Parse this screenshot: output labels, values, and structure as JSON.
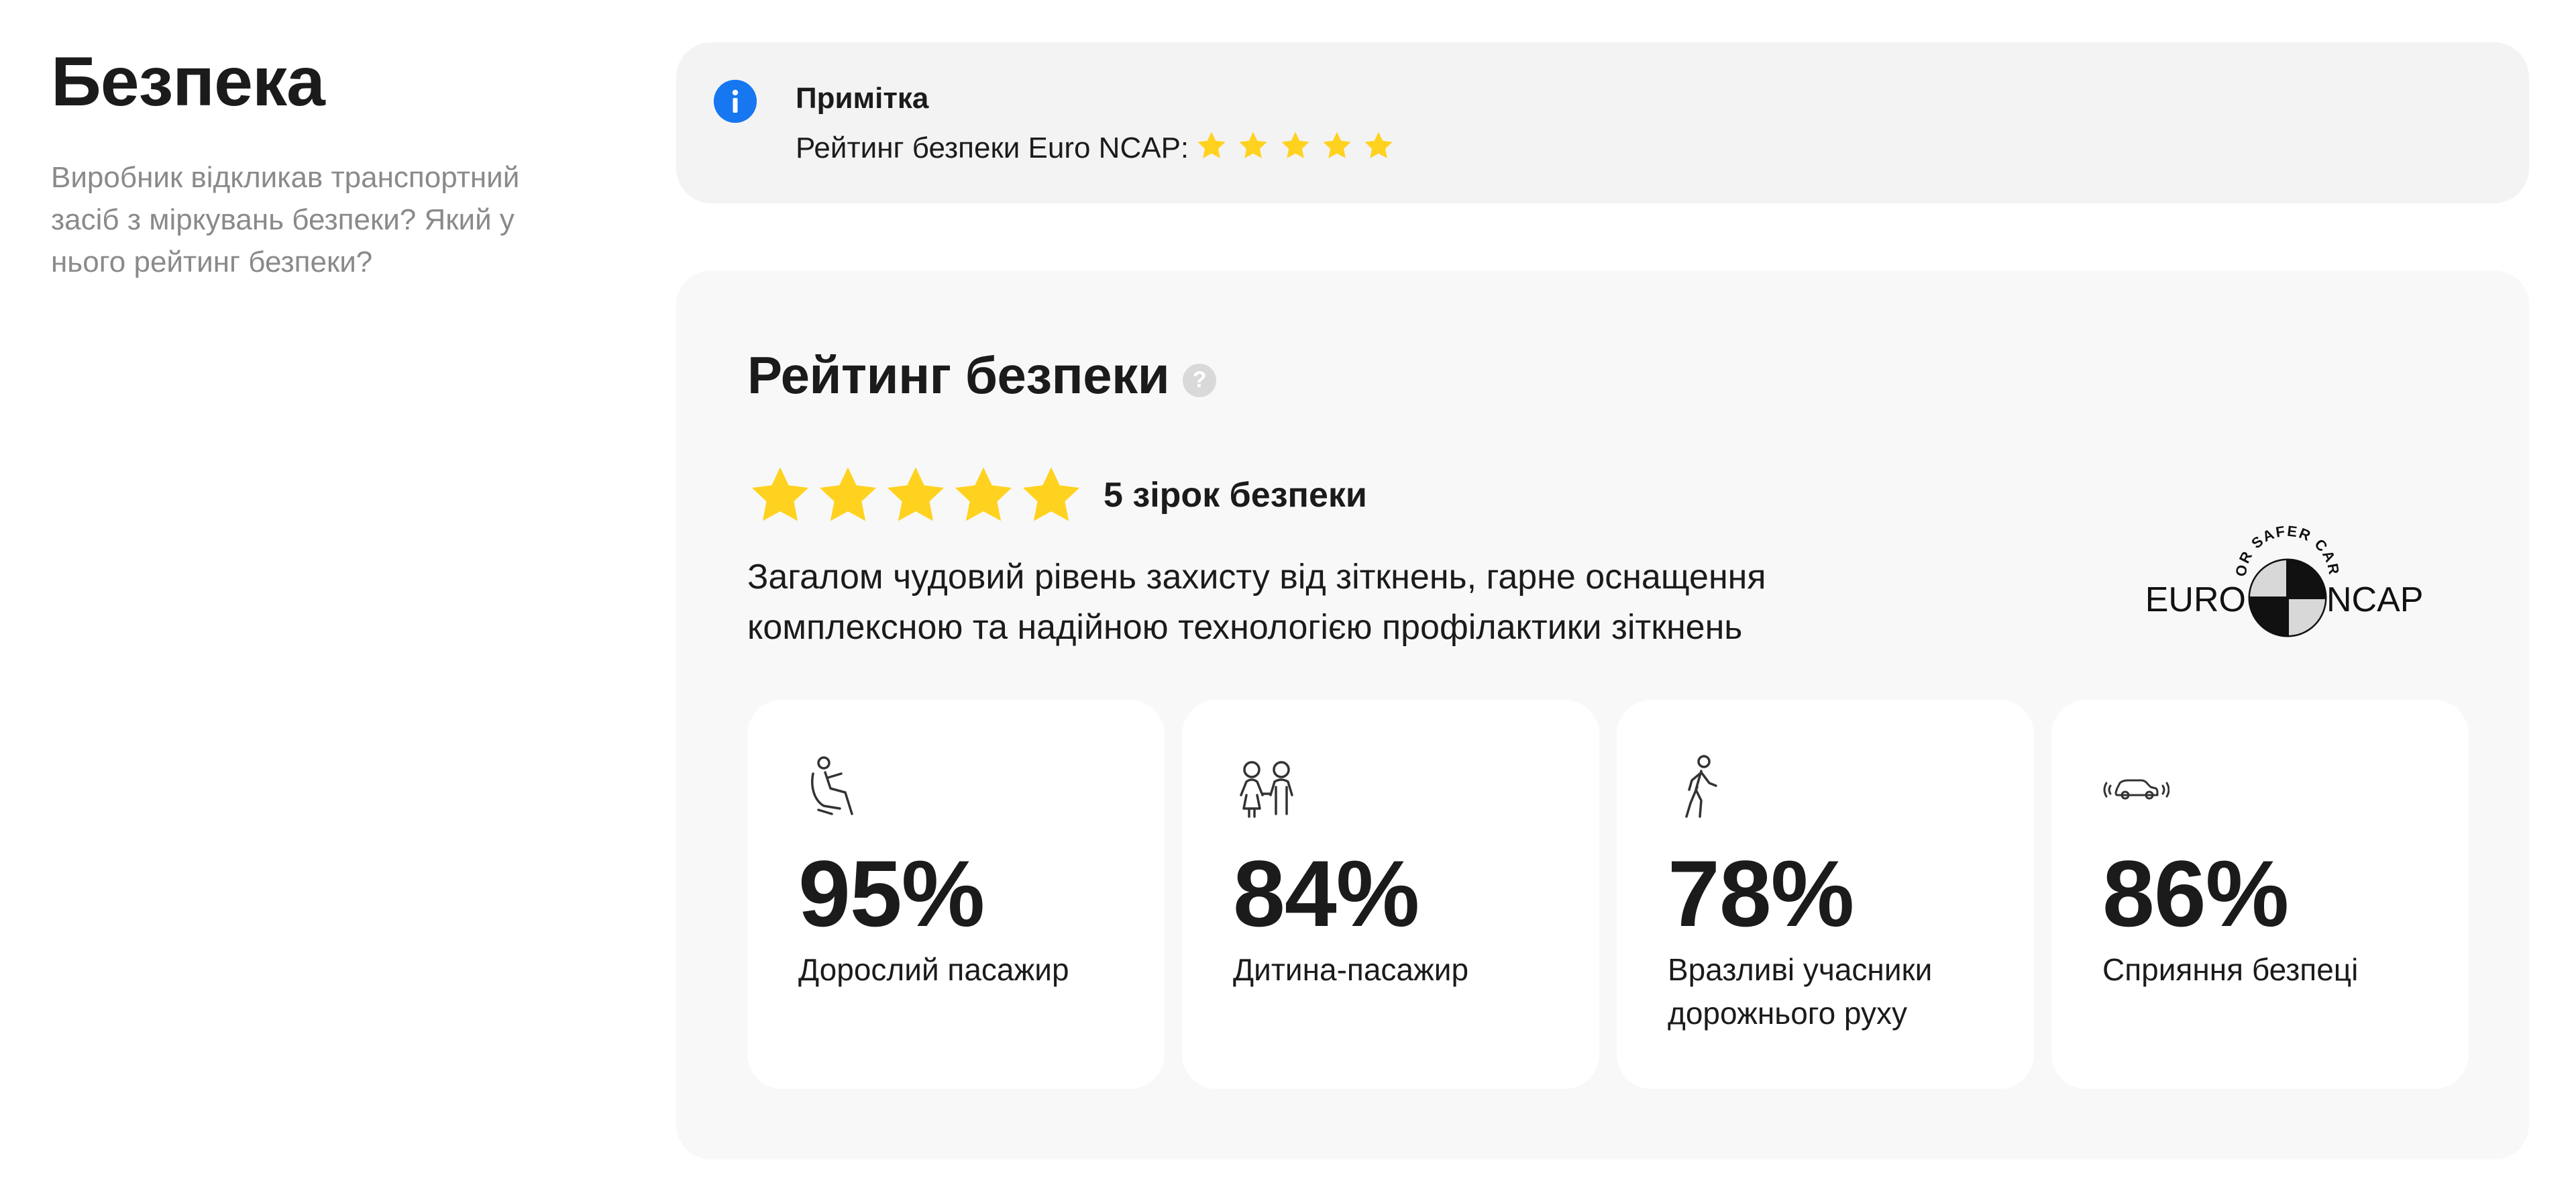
{
  "section": {
    "title": "Безпека",
    "subtitle": "Виробник відкликав транспортний засіб з міркувань безпеки? Який у нього рейтинг безпеки?"
  },
  "note": {
    "icon": "info-icon",
    "title": "Примітка",
    "text": "Рейтинг безпеки Euro NCAP:",
    "stars": 5
  },
  "rating": {
    "title": "Рейтинг безпеки",
    "help_icon": "help-icon",
    "help_glyph": "?",
    "stars": 5,
    "stars_label": "5 зірок безпеки",
    "description": "Загалом чудовий рівень захисту від зіткнень, гарне оснащення комплексною та надійною технологією профілактики зіткнень",
    "logo": {
      "left": "EURO",
      "right": "NCAP",
      "arc": "FOR SAFER CARS"
    },
    "stats": [
      {
        "icon": "seated-adult-icon",
        "value": "95%",
        "label": "Дорослий пасажир"
      },
      {
        "icon": "children-icon",
        "value": "84%",
        "label": "Дитина-пасажир"
      },
      {
        "icon": "pedestrian-icon",
        "value": "78%",
        "label": "Вразливі учасники дорожнього руху"
      },
      {
        "icon": "car-sensor-icon",
        "value": "86%",
        "label": "Сприяння безпеці"
      }
    ]
  },
  "colors": {
    "star": "#ffd21f",
    "info_blue": "#1677f0",
    "card_bg": "#f8f8f8",
    "note_bg": "#f3f3f3",
    "muted_text": "#8a8a8a"
  }
}
